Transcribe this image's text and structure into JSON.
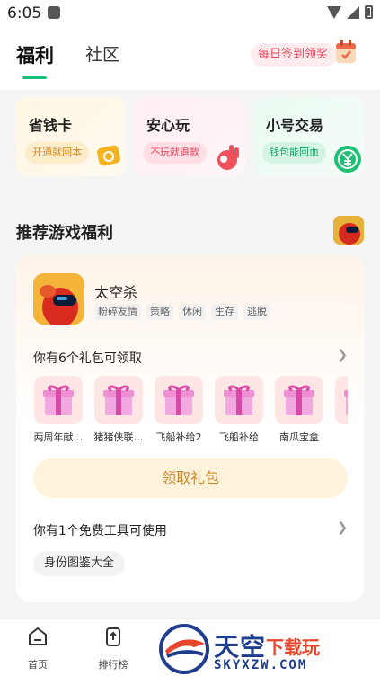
{
  "status": {
    "time": "6:05"
  },
  "header": {
    "tabs": [
      {
        "label": "福利"
      },
      {
        "label": "社区"
      }
    ],
    "checkin_label": "每日签到领奖"
  },
  "feature_cards": [
    {
      "title": "省钱卡",
      "pill": "开通就回本",
      "color": "#f5a623"
    },
    {
      "title": "安心玩",
      "pill": "不玩就退款",
      "color": "#e5435a"
    },
    {
      "title": "小号交易",
      "pill": "钱包能回血",
      "color": "#19b46e"
    }
  ],
  "section": {
    "title": "推荐游戏福利"
  },
  "game": {
    "name": "太空杀",
    "tags": [
      "粉碎友情",
      "策略",
      "休闲",
      "生存",
      "逃脱"
    ]
  },
  "gifts": {
    "title": "你有6个礼包可领取",
    "items": [
      {
        "label": "两周年献…"
      },
      {
        "label": "猪猪侠联…"
      },
      {
        "label": "飞船补给2"
      },
      {
        "label": "飞船补给"
      },
      {
        "label": "南瓜宝盒"
      },
      {
        "label": "捣"
      }
    ],
    "claim_label": "领取礼包"
  },
  "tools": {
    "title": "你有1个免费工具可使用",
    "items": [
      {
        "label": "身份图鉴大全"
      }
    ]
  },
  "bottom_nav": [
    {
      "label": "首页",
      "icon": "home-icon"
    },
    {
      "label": "排行榜",
      "icon": "ranking-icon"
    }
  ],
  "watermark": {
    "brand": "天空",
    "brand_suffix": "下载玩",
    "url": "SKYXZW.COM"
  },
  "colors": {
    "accent": "#19c07a",
    "gift_text": "#c9892f"
  }
}
